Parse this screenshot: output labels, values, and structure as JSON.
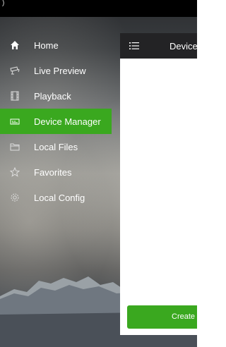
{
  "menu": {
    "items": [
      {
        "label": "Home",
        "icon": "home-icon",
        "active": false
      },
      {
        "label": "Live Preview",
        "icon": "camera-icon",
        "active": false
      },
      {
        "label": "Playback",
        "icon": "film-icon",
        "active": false
      },
      {
        "label": "Device Manager",
        "icon": "device-icon",
        "active": true
      },
      {
        "label": "Local Files",
        "icon": "folder-icon",
        "active": false
      },
      {
        "label": "Favorites",
        "icon": "star-icon",
        "active": false
      },
      {
        "label": "Local Config",
        "icon": "gear-icon",
        "active": false
      }
    ]
  },
  "panel": {
    "title": "Device",
    "create_label": "Create"
  },
  "colors": {
    "accent": "#3aa81f",
    "header": "#232325",
    "status_bar": "#000000"
  }
}
